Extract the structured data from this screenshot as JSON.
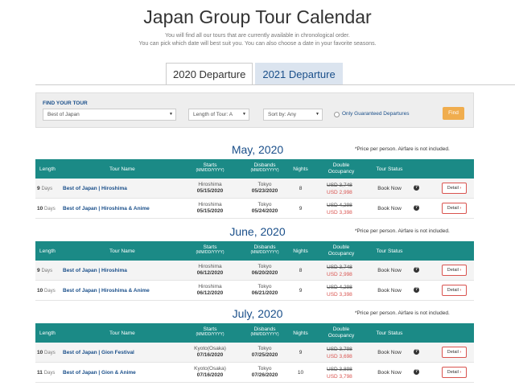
{
  "header": {
    "title": "Japan Group Tour Calendar",
    "intro_line1": "You will find all our tours that are currently available in chronological order.",
    "intro_line2": "You can pick which date will best suit you. You can also choose a date in your favorite seasons."
  },
  "tabs": [
    {
      "label": "2020 Departure",
      "active": true
    },
    {
      "label": "2021 Departure",
      "active": false
    }
  ],
  "finder": {
    "label": "FIND YOUR TOUR",
    "tour_select": "Best of Japan",
    "length_select": "Length of Tour: A",
    "sort_select": "Sort by: Any",
    "checkbox_label": "Only Guaranteed Departures",
    "find_label": "Find"
  },
  "columns": {
    "length": "Length",
    "tour_name": "Tour Name",
    "starts": "Starts",
    "starts_sub": "(MM/DD/YYYY)",
    "disbands": "Disbands",
    "disbands_sub": "(MM/DD/YYYY)",
    "nights": "Nights",
    "double": "Double",
    "occupancy": "Occupancy",
    "status": "Tour Status"
  },
  "price_note": "*Price per person. Airfare is not included.",
  "days_unit": "Days",
  "detail_label": "Detail",
  "months": [
    {
      "title": "May, 2020",
      "rows": [
        {
          "days": "9",
          "name": "Best of Japan | Hiroshima",
          "start_city": "Hiroshima",
          "start_date": "05/15/2020",
          "end_city": "Tokyo",
          "end_date": "05/23/2020",
          "nights": "8",
          "old_price": "USD 3,748",
          "new_price": "USD 2,998",
          "status": "Book Now"
        },
        {
          "days": "10",
          "name": "Best of Japan | Hiroshima & Anime",
          "start_city": "Hiroshima",
          "start_date": "05/15/2020",
          "end_city": "Tokyo",
          "end_date": "05/24/2020",
          "nights": "9",
          "old_price": "USD 4,298",
          "new_price": "USD 3,398",
          "status": "Book Now"
        }
      ]
    },
    {
      "title": "June, 2020",
      "rows": [
        {
          "days": "9",
          "name": "Best of Japan | Hiroshima",
          "start_city": "Hiroshima",
          "start_date": "06/12/2020",
          "end_city": "Tokyo",
          "end_date": "06/20/2020",
          "nights": "8",
          "old_price": "USD 3,748",
          "new_price": "USD 2,998",
          "status": "Book Now"
        },
        {
          "days": "10",
          "name": "Best of Japan | Hiroshima & Anime",
          "start_city": "Hiroshima",
          "start_date": "06/12/2020",
          "end_city": "Tokyo",
          "end_date": "06/21/2020",
          "nights": "9",
          "old_price": "USD 4,298",
          "new_price": "USD 3,398",
          "status": "Book Now"
        }
      ]
    },
    {
      "title": "July, 2020",
      "rows": [
        {
          "days": "10",
          "name": "Best of Japan | Gion Festival",
          "start_city": "Kyoto(Osaka)",
          "start_date": "07/16/2020",
          "end_city": "Tokyo",
          "end_date": "07/25/2020",
          "nights": "9",
          "old_price": "USD 3,798",
          "new_price": "USD 3,698",
          "status": "Book Now"
        },
        {
          "days": "11",
          "name": "Best of Japan | Gion & Anime",
          "start_city": "Kyoto(Osaka)",
          "start_date": "07/16/2020",
          "end_city": "Tokyo",
          "end_date": "07/26/2020",
          "nights": "10",
          "old_price": "USD 3,898",
          "new_price": "USD 3,798",
          "status": "Book Now"
        }
      ]
    }
  ]
}
